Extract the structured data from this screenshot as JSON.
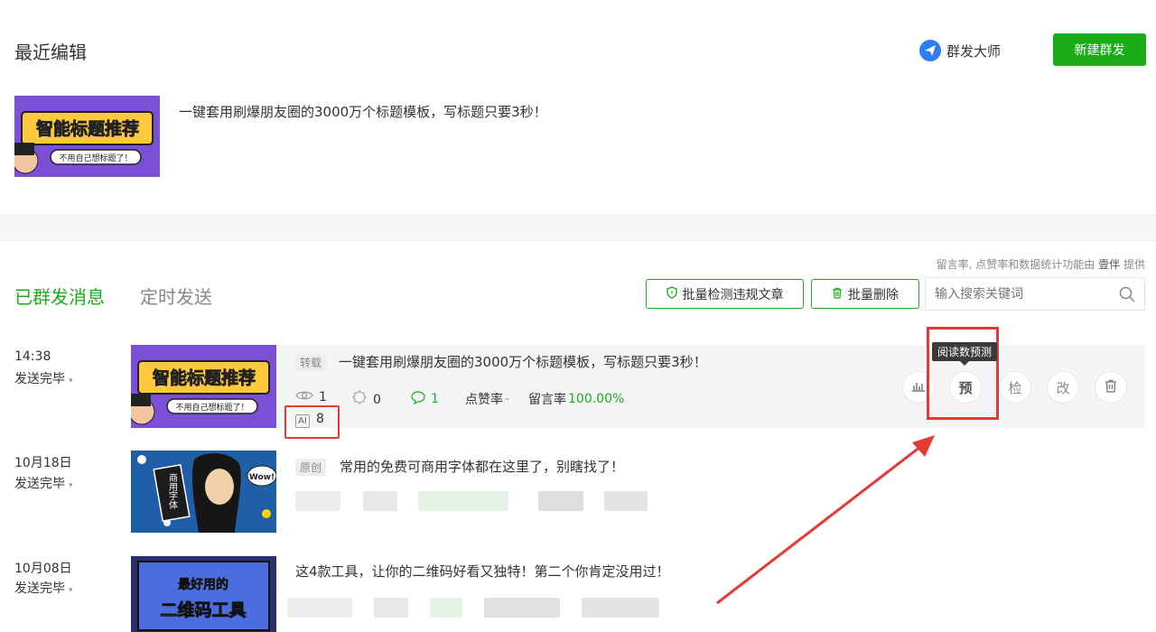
{
  "recent": {
    "title": "最近编辑",
    "mass_master": "群发大师",
    "new_button": "新建群发",
    "draft_title": "一键套用刷爆朋友圈的3000万个标题模板，写标题只要3秒！",
    "thumb_text": "智能标题推荐",
    "thumb_sub": "不用自己想标题了！"
  },
  "provider": {
    "prefix": "留言率, 点赞率和数据统计功能由",
    "brand": "壹伴",
    "suffix": "提供"
  },
  "tabs": {
    "sent": "已群发消息",
    "scheduled": "定时发送"
  },
  "toolbar": {
    "check_button": "批量检测违规文章",
    "delete_button": "批量删除",
    "search_placeholder": "输入搜索关键词"
  },
  "articles": [
    {
      "time": "14:38",
      "status": "发送完毕",
      "badge": "转载",
      "title": "一键套用刷爆朋友圈的3000万个标题模板，写标题只要3秒！",
      "thumb_text": "智能标题推荐",
      "thumb_sub": "不用自己想标题了！",
      "views": "1",
      "shares": "0",
      "comments": "1",
      "like_rate_label": "点赞率",
      "like_rate_value": "-",
      "comment_rate_label": "留言率",
      "comment_rate_value": "100.00%",
      "ai_label": "AI",
      "ai_value": "8"
    },
    {
      "time": "10月18日",
      "status": "发送完毕",
      "badge": "原创",
      "title": "常用的免费可商用字体都在这里了，别瞎找了！",
      "thumb_text": "商用字体",
      "thumb_sub": "Wow!"
    },
    {
      "time": "10月08日",
      "status": "发送完毕",
      "title": "这4款工具，让你的二维码好看又独特！第二个你肯定没用过！",
      "thumb_text": "二维码工具",
      "thumb_sub": "最好用的"
    }
  ],
  "actions": {
    "stats_icon": "bar-chart-icon",
    "predict": "预",
    "check": "检",
    "edit": "改",
    "delete_icon": "trash-icon"
  },
  "tooltip": "阅读数预测",
  "colors": {
    "accent": "#1aad19",
    "annotation": "#e53935",
    "brand_blue": "#2e7cf6"
  }
}
